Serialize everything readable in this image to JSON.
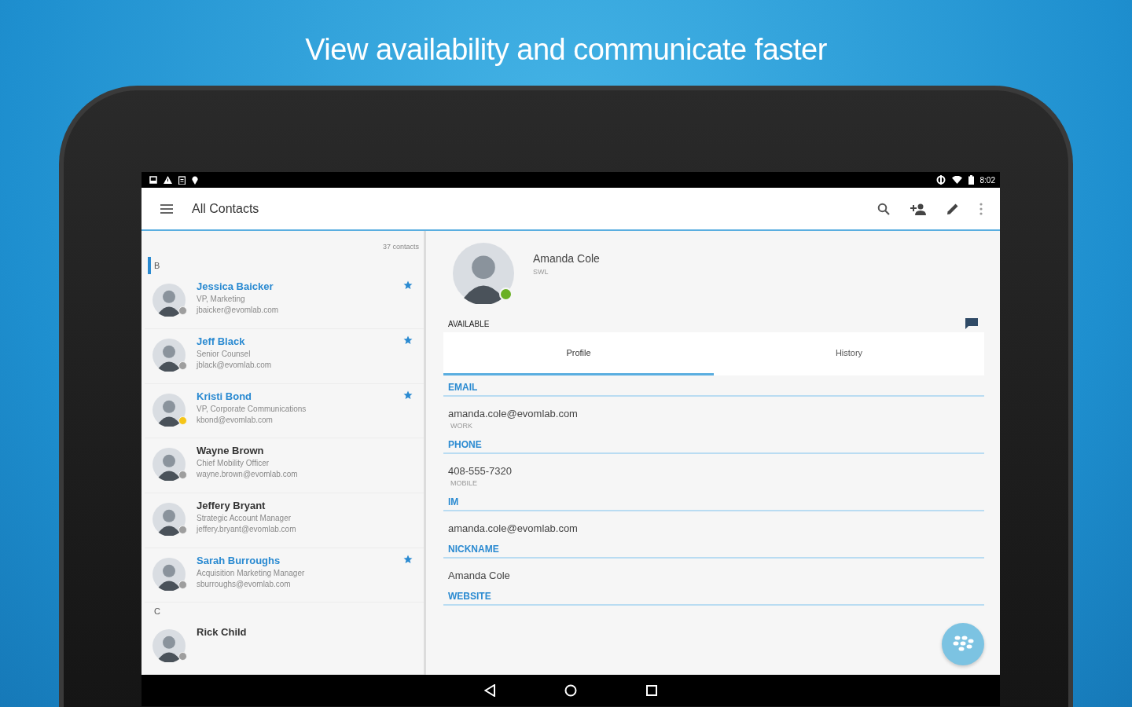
{
  "headline": "View availability and communicate faster",
  "status_bar": {
    "time": "8:02"
  },
  "app_bar": {
    "title": "All Contacts"
  },
  "contacts": {
    "count": "37 contacts",
    "groups": [
      {
        "letter": "B",
        "selected": true,
        "items": [
          {
            "name": "Jessica Baicker",
            "title": "VP, Marketing",
            "email": "jbaicker@evomlab.com",
            "favorite": true,
            "color": "#9e9e9e"
          },
          {
            "name": "Jeff Black",
            "title": "Senior Counsel",
            "email": "jblack@evomlab.com",
            "favorite": true,
            "color": "#9e9e9e"
          },
          {
            "name": "Kristi Bond",
            "title": "VP, Corporate Communications",
            "email": "kbond@evomlab.com",
            "favorite": true,
            "color": "#f5c518"
          },
          {
            "name": "Wayne Brown",
            "title": "Chief Mobility Officer",
            "email": "wayne.brown@evomlab.com",
            "favorite": false,
            "color": "#9e9e9e"
          },
          {
            "name": "Jeffery Bryant",
            "title": "Strategic Account Manager",
            "email": "jeffery.bryant@evomlab.com",
            "favorite": false,
            "color": "#9e9e9e"
          },
          {
            "name": "Sarah Burroughs",
            "title": "Acquisition Marketing Manager",
            "email": "sburroughs@evomlab.com",
            "favorite": true,
            "color": "#9e9e9e"
          }
        ]
      },
      {
        "letter": "C",
        "selected": false,
        "items": [
          {
            "name": "Rick Child",
            "favorite": false,
            "color": "#9e9e9e"
          }
        ]
      }
    ]
  },
  "detail": {
    "name": "Amanda Cole",
    "subtitle": "SWL",
    "color": "#6ab023",
    "status": "AVAILABLE",
    "tabs": [
      {
        "label": "Profile",
        "selected": true
      },
      {
        "label": "History",
        "selected": false
      }
    ],
    "sections": [
      {
        "label": "EMAIL",
        "value": "amanda.cole@evomlab.com",
        "type": "WORK"
      },
      {
        "label": "PHONE",
        "value": "408-555-7320",
        "type": "MOBILE"
      },
      {
        "label": "IM",
        "value": "amanda.cole@evomlab.com"
      },
      {
        "label": "NICKNAME",
        "value": "Amanda Cole"
      },
      {
        "label": "WEBSITE"
      }
    ]
  }
}
